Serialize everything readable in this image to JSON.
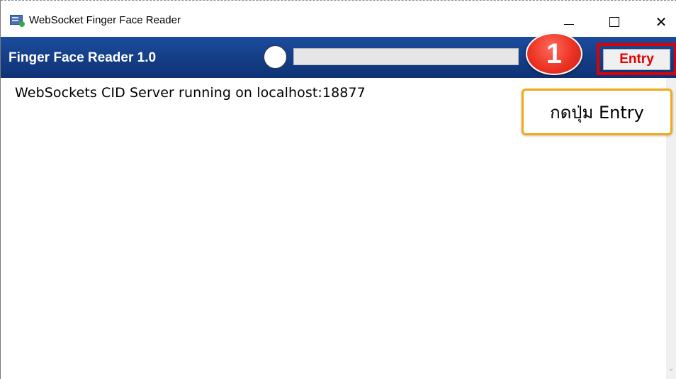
{
  "window": {
    "title": "WebSocket Finger Face Reader",
    "controls": {
      "minimize_icon": "minimize-icon",
      "maximize_icon": "maximize-icon",
      "close_icon": "close-icon",
      "close_glyph": "✕"
    }
  },
  "header": {
    "app_name": "Finger Face Reader 1.0",
    "status_indicator": "white-circle",
    "progress": 0,
    "entry_button_label": "Entry"
  },
  "log": {
    "lines": [
      "WebSockets CID Server running on localhost:18877"
    ]
  },
  "annotation": {
    "step_number": "1",
    "callout_text": "กดปุ่ม Entry",
    "colors": {
      "badge": "#ec3323",
      "highlight": "#e10000",
      "callout_border": "#f2a917"
    }
  },
  "colors": {
    "header_bg": "#153f88",
    "entry_text": "#e10000"
  }
}
